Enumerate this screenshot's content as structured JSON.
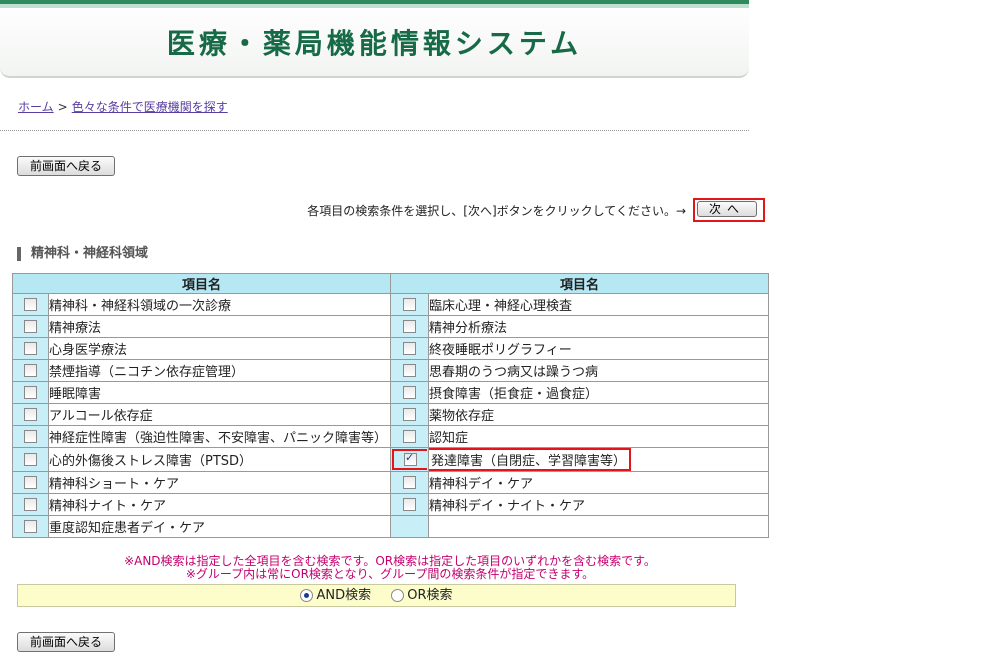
{
  "header": {
    "title": "医療・薬局機能情報システム"
  },
  "breadcrumb": {
    "home": "ホーム",
    "separator": ">",
    "current": "色々な条件で医療機関を探す"
  },
  "buttons": {
    "back": "前画面へ戻る",
    "next": "次へ"
  },
  "instruction": "各項目の検索条件を選択し、[次へ]ボタンをクリックしてください。→",
  "section": {
    "title": "精神科・神経科領域"
  },
  "table": {
    "header_left": "項目名",
    "header_right": "項目名",
    "left": [
      {
        "label": "精神科・神経科領域の一次診療",
        "checked": false
      },
      {
        "label": "精神療法",
        "checked": false
      },
      {
        "label": "心身医学療法",
        "checked": false
      },
      {
        "label": "禁煙指導（ニコチン依存症管理）",
        "checked": false
      },
      {
        "label": "睡眠障害",
        "checked": false
      },
      {
        "label": "アルコール依存症",
        "checked": false
      },
      {
        "label": "神経症性障害（強迫性障害、不安障害、パニック障害等）",
        "checked": false
      },
      {
        "label": "心的外傷後ストレス障害（PTSD）",
        "checked": false
      },
      {
        "label": "精神科ショート・ケア",
        "checked": false
      },
      {
        "label": "精神科ナイト・ケア",
        "checked": false
      },
      {
        "label": "重度認知症患者デイ・ケア",
        "checked": false
      }
    ],
    "right": [
      {
        "label": "臨床心理・神経心理検査",
        "checked": false
      },
      {
        "label": "精神分析療法",
        "checked": false
      },
      {
        "label": "終夜睡眠ポリグラフィー",
        "checked": false
      },
      {
        "label": "思春期のうつ病又は躁うつ病",
        "checked": false
      },
      {
        "label": "摂食障害（拒食症・過食症）",
        "checked": false
      },
      {
        "label": "薬物依存症",
        "checked": false
      },
      {
        "label": "認知症",
        "checked": false
      },
      {
        "label": "発達障害（自閉症、学習障害等）",
        "checked": true
      },
      {
        "label": "精神科デイ・ケア",
        "checked": false
      },
      {
        "label": "精神科デイ・ナイト・ケア",
        "checked": false
      }
    ]
  },
  "notes": {
    "line1": "※AND検索は指定した全項目を含む検索です。OR検索は指定した項目のいずれかを含む検索です。",
    "line2": "※グループ内は常にOR検索となり、グループ間の検索条件が指定できます。"
  },
  "search_mode": {
    "and_label": "AND検索",
    "or_label": "OR検索",
    "selected": "AND"
  },
  "colors": {
    "accent_green": "#166a46",
    "table_header": "#b6e8f4",
    "checkbox_cell": "#c8eef8",
    "highlight": "#e2161a",
    "note_text": "#c4006f",
    "search_bar": "#fdfdcc"
  }
}
